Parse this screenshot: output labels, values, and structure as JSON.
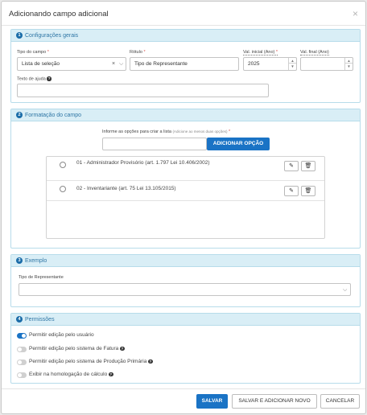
{
  "modal": {
    "title": "Adicionando campo adicional",
    "close": "×"
  },
  "section1": {
    "num": "1",
    "title": "Configurações gerais",
    "tipo_label": "Tipo do campo",
    "tipo_value": "Lista de seleção",
    "rotulo_label": "Rótulo",
    "rotulo_value": "Tipo de Representante",
    "val_inicial_label": "Val. inicial (Ano)",
    "val_inicial_value": "2025",
    "val_final_label": "Val. final (Ano)",
    "val_final_value": "",
    "texto_ajuda_label": "Texto de ajuda",
    "texto_ajuda_value": "",
    "required_mark": "*"
  },
  "section2": {
    "num": "2",
    "title": "Formatação do campo",
    "informe_label": "Informe as opções para criar a lista",
    "informe_hint": "(Adicione ao menos duas opções)",
    "add_option_button": "ADICIONAR OPÇÃO",
    "options": [
      "01 - Administrador Provisório (art. 1.797 Lei 10.406/2002)",
      "02 - Inventariante (art. 75 Lei 13.105/2015)"
    ]
  },
  "section3": {
    "num": "3",
    "title": "Exemplo",
    "example_label": "Tipo de Representante"
  },
  "section4": {
    "num": "4",
    "title": "Permissões",
    "permissions": [
      {
        "label": "Permitir edição pelo usuário",
        "enabled": true,
        "help": false
      },
      {
        "label": "Permitir edição pelo sistema de Fatura",
        "enabled": false,
        "help": true
      },
      {
        "label": "Permitir edição pelo sistema de Produção Primária",
        "enabled": false,
        "help": true
      },
      {
        "label": "Exibir na homologação de cálculo",
        "enabled": false,
        "help": true
      }
    ]
  },
  "footer": {
    "save": "SALVAR",
    "save_new": "SALVAR E ADICIONAR NOVO",
    "cancel": "CANCELAR"
  },
  "colors": {
    "primary": "#1a73c5",
    "section_bg": "#d9eef6",
    "section_border": "#b7dcea",
    "section_title": "#2f76a5",
    "required": "#d9534f"
  }
}
